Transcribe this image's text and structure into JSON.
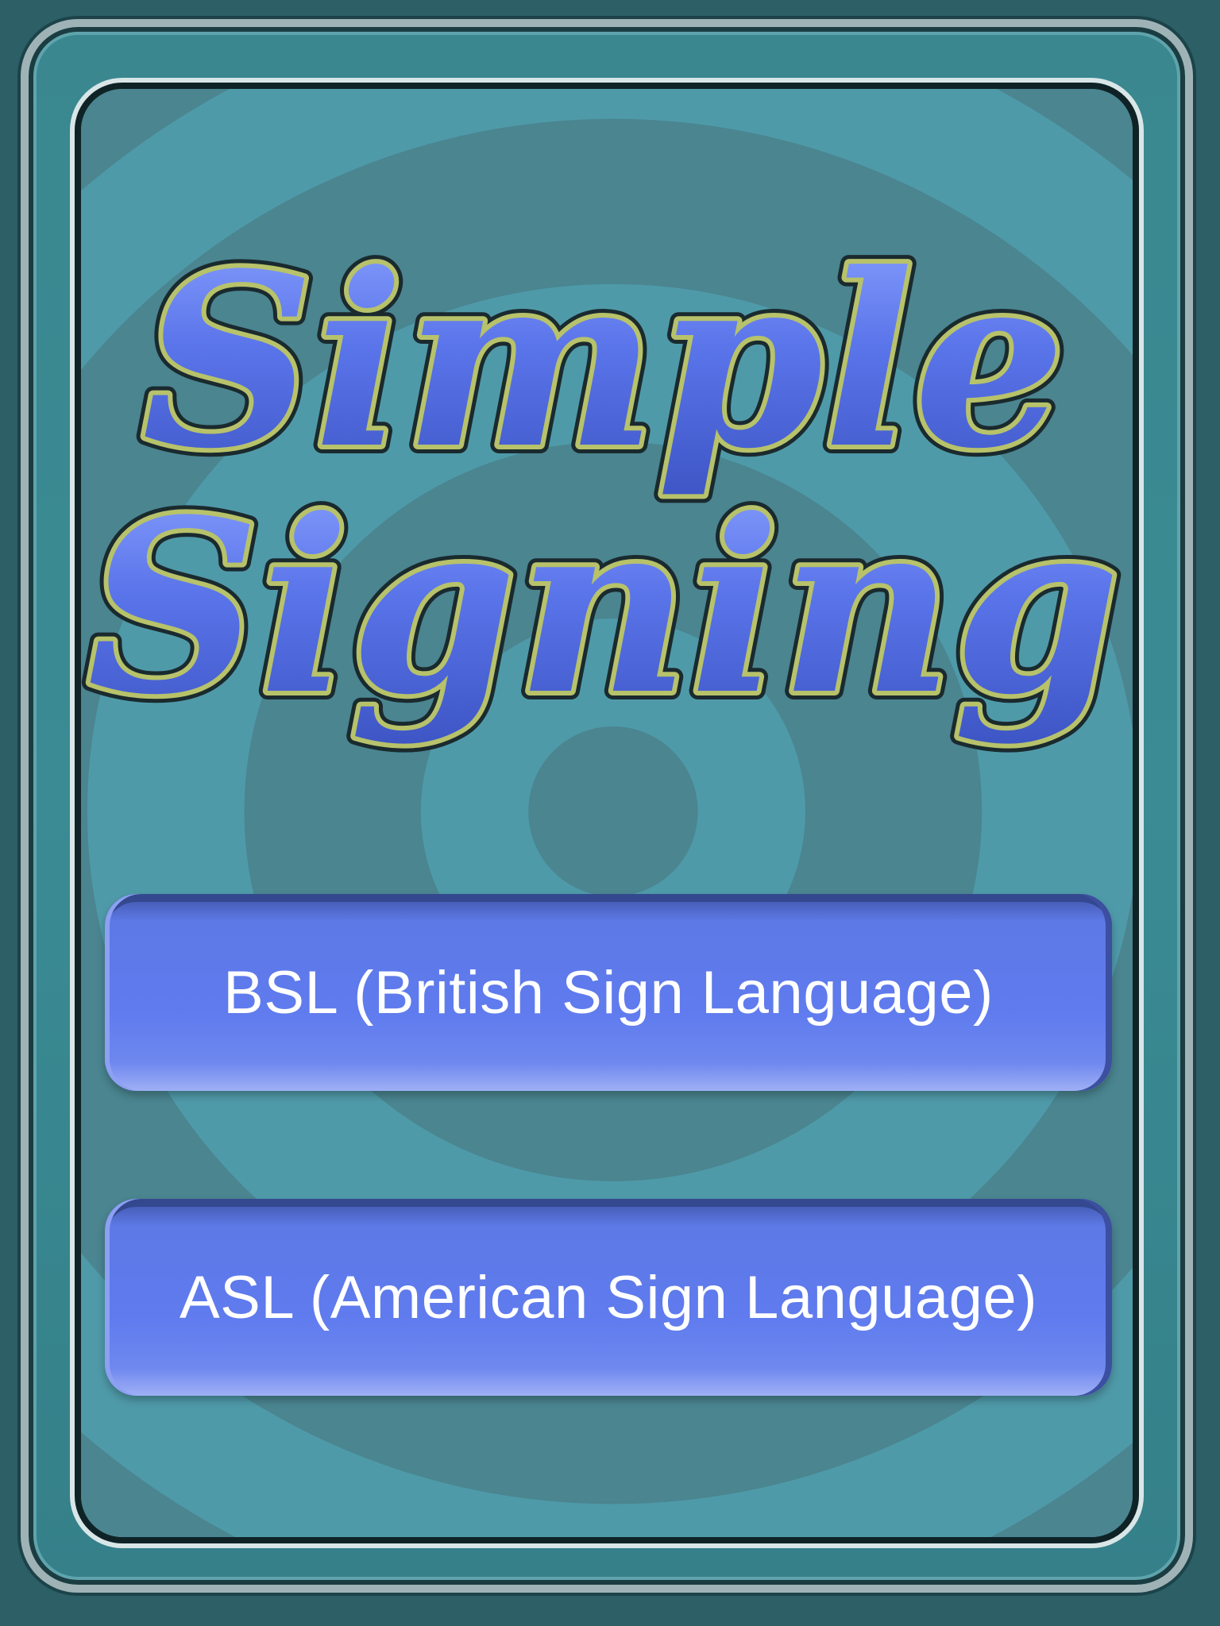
{
  "app": {
    "title_line1": "Simple",
    "title_line2": "Signing"
  },
  "buttons": {
    "bsl_label": "BSL (British Sign Language)",
    "asl_label": "ASL (American Sign Language)"
  },
  "colors": {
    "frame": "#3a878f",
    "panel": "#4a8590",
    "ring_light": "#4f9aa8",
    "button": "#5f7bee",
    "title_fill": "#5470e6",
    "title_outline": "#b7c26a"
  }
}
